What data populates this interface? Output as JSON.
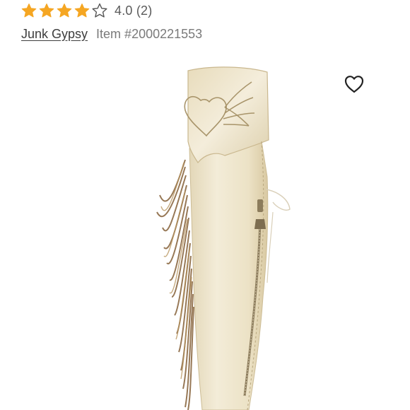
{
  "listing": {
    "rating": {
      "stars_filled": 4,
      "stars_total": 5,
      "text": "4.0 (2)",
      "star_color": "#f5a623"
    },
    "brand": "Junk Gypsy",
    "item_number": "Item #2000221553"
  },
  "icons": {
    "like": "heart-outline-icon"
  },
  "colors": {
    "text_primary": "#3d3d3d",
    "text_secondary": "#7a7a7a",
    "boot_leather": "#efe6cf",
    "fringe": "#8a6a45"
  }
}
